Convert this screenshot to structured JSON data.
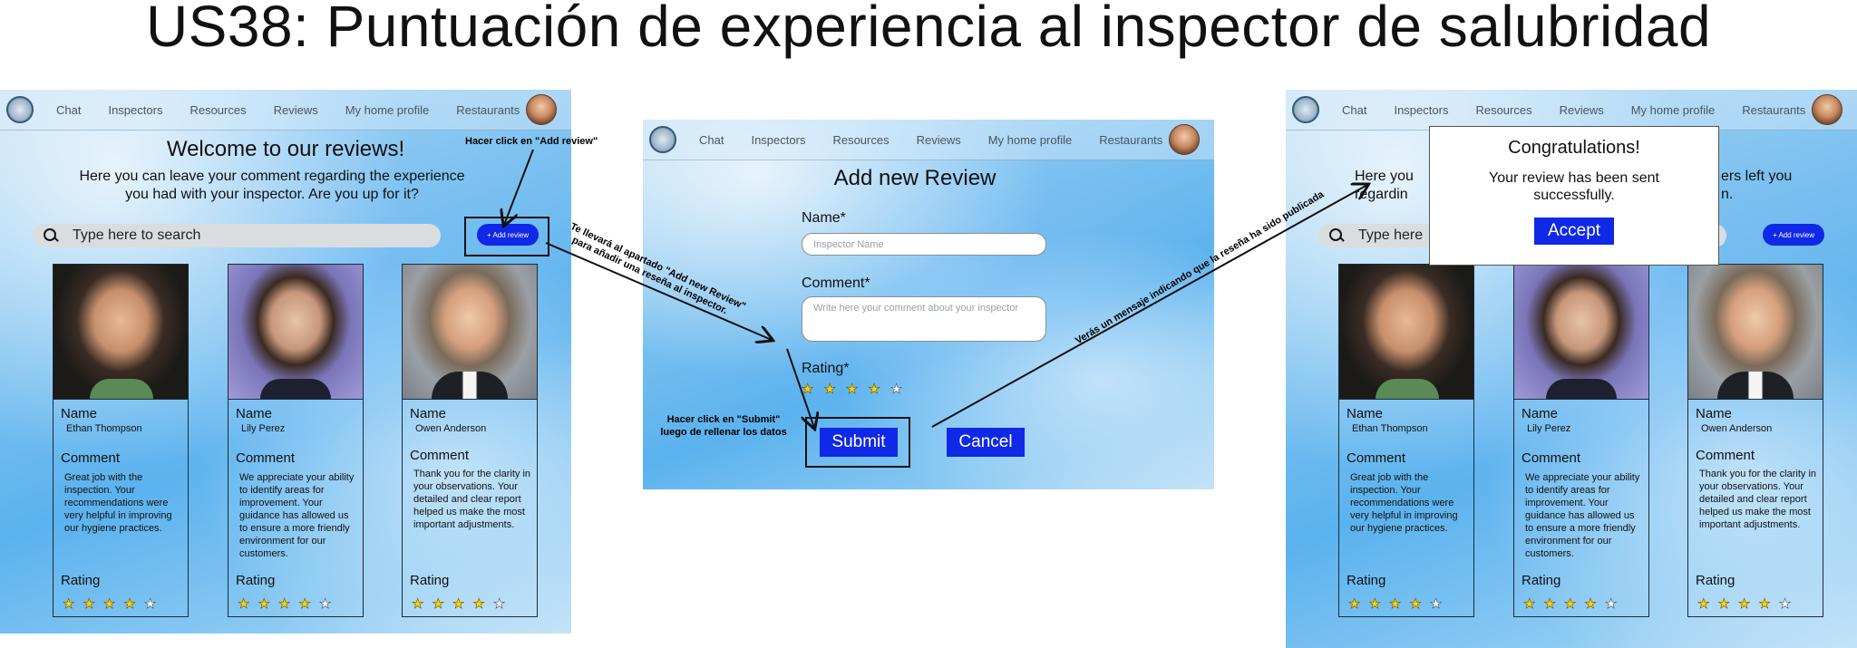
{
  "page_title": "US38: Puntuación de experiencia al inspector de salubridad",
  "nav": {
    "items": [
      "Chat",
      "Inspectors",
      "Resources",
      "Reviews",
      "My home profile",
      "Restaurants"
    ]
  },
  "reviews_page": {
    "heading": "Welcome to our reviews!",
    "subtitle_line1": "Here you can leave your comment regarding the experience",
    "subtitle_line2": "you had with your inspector. Are you up for it?",
    "search_placeholder": "Type here to search",
    "add_review_label": "+ Add review",
    "name_label": "Name",
    "comment_label": "Comment",
    "rating_label": "Rating",
    "cards": [
      {
        "name": "Ethan Thompson",
        "comment": "Great job with the inspection. Your recommendations were very helpful in improving our hygiene practices.",
        "rating": 4
      },
      {
        "name": "Lily Perez",
        "comment": "We appreciate your ability to identify areas for improvement. Your guidance has allowed us to ensure a more friendly environment for our customers.",
        "rating": 4
      },
      {
        "name": "Owen Anderson",
        "comment": "Thank you for the clarity in your observations. Your detailed and clear report helped us make the most important adjustments.",
        "rating": 4
      }
    ]
  },
  "add_review_form": {
    "heading": "Add new Review",
    "name_label": "Name*",
    "name_placeholder": "Inspector Name",
    "comment_label": "Comment*",
    "comment_placeholder": "Write here your comment about your inspector",
    "rating_label": "Rating*",
    "rating": 4,
    "submit_label": "Submit",
    "cancel_label": "Cancel"
  },
  "confirmation_page": {
    "subtitle_partial_left_1": "Here you",
    "subtitle_partial_left_2": "regardin",
    "subtitle_partial_right_1": "ers left you",
    "subtitle_partial_right_2": "n.",
    "search_partial": "Type here",
    "modal": {
      "title": "Congratulations!",
      "message_line1": "Your review has been sent",
      "message_line2": "successfully.",
      "accept_label": "Accept"
    }
  },
  "annotations": {
    "click_add_review": "Hacer click en \"Add review\"",
    "redirect_line1": "Te llevará al apartado \"Add new Review\"",
    "redirect_line2": "para añadir una reseña al inspector.",
    "click_submit_line1": "Hacer click en \"Submit\"",
    "click_submit_line2": "luego de rellenar los datos",
    "confirmation_message": "Verás un mensaje indicando que la reseña ha sido publicada"
  },
  "colors": {
    "primary_button": "#1029e6",
    "star_filled": "#ffd500",
    "star_empty": "#ffffff"
  }
}
